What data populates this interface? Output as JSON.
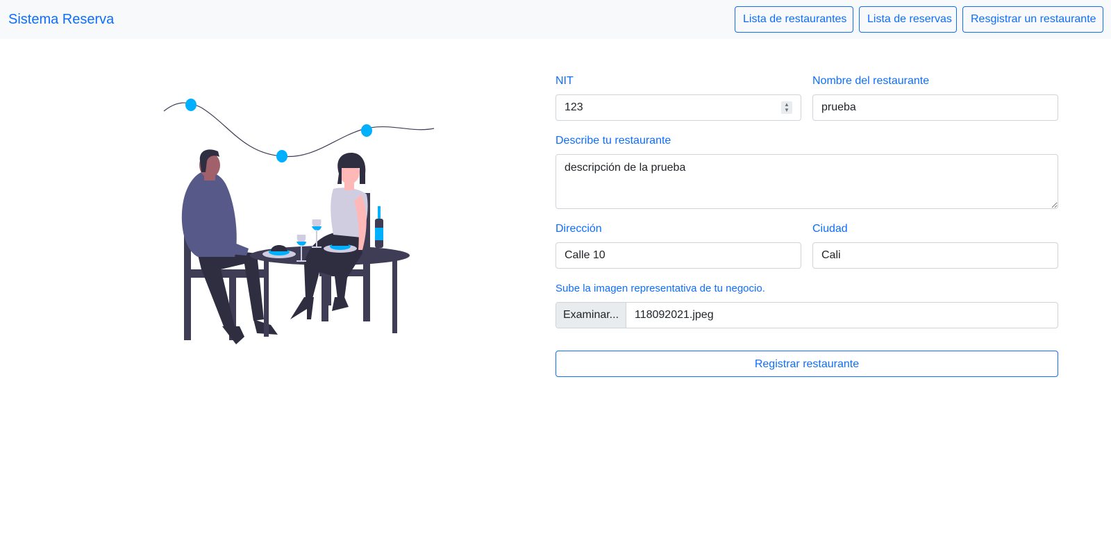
{
  "navbar": {
    "brand": "Sistema Reserva",
    "links": [
      {
        "label": "Lista de restaurantes"
      },
      {
        "label": "Lista de reservas"
      },
      {
        "label": "Resgistrar un restaurante"
      }
    ]
  },
  "form": {
    "nit": {
      "label": "NIT",
      "value": "123"
    },
    "name": {
      "label": "Nombre del restaurante",
      "value": "prueba"
    },
    "description": {
      "label": "Describe tu restaurante",
      "value": "descripción de la prueba"
    },
    "address": {
      "label": "Dirección",
      "value": "Calle 10"
    },
    "city": {
      "label": "Ciudad",
      "value": "Cali"
    },
    "image": {
      "label": "Sube la imagen representativa de tu negocio.",
      "button": "Examinar...",
      "filename": "118092021.jpeg"
    },
    "submit": "Registrar restaurante"
  },
  "colors": {
    "primary": "#0d6efd",
    "accent": "#00b0ff",
    "navbar_bg": "#f8f9fa",
    "figure_dark": "#3f3d56",
    "shirt": "#575a89",
    "skin_dark": "#a0616a"
  }
}
